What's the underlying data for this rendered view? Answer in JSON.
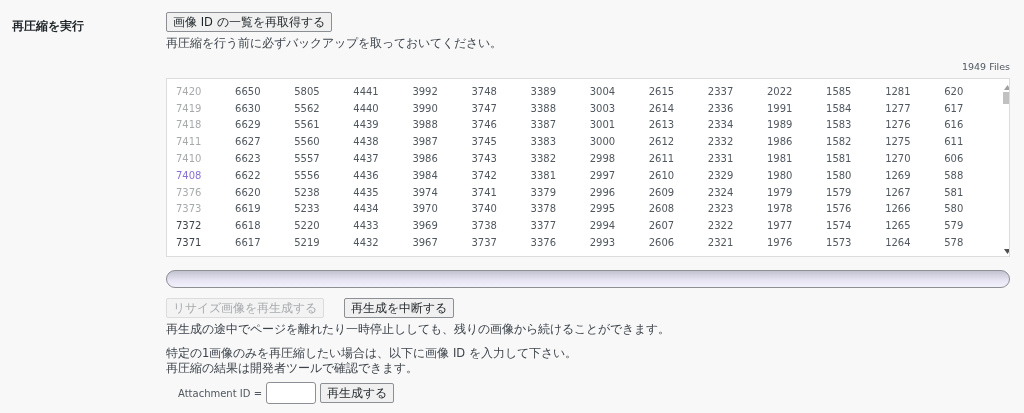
{
  "section_label": "再圧縮を実行",
  "refetch_button": {
    "label": "画像 ID の一覧を再取得する"
  },
  "backup_note": "再圧縮を行う前に必ずバックアップを取っておいてください。",
  "file_count": "1949 Files",
  "id_list": {
    "rows": [
      {
        "processed": true,
        "active": false,
        "ids": [
          "7420",
          "6650",
          "5805",
          "4441",
          "3992",
          "3748",
          "3389",
          "3004",
          "2615",
          "2337",
          "2022",
          "1585",
          "1281",
          "620"
        ]
      },
      {
        "processed": true,
        "active": false,
        "ids": [
          "7419",
          "6630",
          "5562",
          "4440",
          "3990",
          "3747",
          "3388",
          "3003",
          "2614",
          "2336",
          "1991",
          "1584",
          "1277",
          "617"
        ]
      },
      {
        "processed": true,
        "active": false,
        "ids": [
          "7418",
          "6629",
          "5561",
          "4439",
          "3988",
          "3746",
          "3387",
          "3001",
          "2613",
          "2334",
          "1989",
          "1583",
          "1276",
          "616"
        ]
      },
      {
        "processed": true,
        "active": false,
        "ids": [
          "7411",
          "6627",
          "5560",
          "4438",
          "3987",
          "3745",
          "3383",
          "3000",
          "2612",
          "2332",
          "1986",
          "1582",
          "1275",
          "611"
        ]
      },
      {
        "processed": true,
        "active": false,
        "ids": [
          "7410",
          "6623",
          "5557",
          "4437",
          "3986",
          "3743",
          "3382",
          "2998",
          "2611",
          "2331",
          "1981",
          "1581",
          "1270",
          "606"
        ]
      },
      {
        "processed": false,
        "active": true,
        "ids": [
          "7408",
          "6622",
          "5556",
          "4436",
          "3984",
          "3742",
          "3381",
          "2997",
          "2610",
          "2329",
          "1980",
          "1580",
          "1269",
          "588"
        ]
      },
      {
        "processed": true,
        "active": false,
        "ids": [
          "7376",
          "6620",
          "5238",
          "4435",
          "3974",
          "3741",
          "3379",
          "2996",
          "2609",
          "2324",
          "1979",
          "1579",
          "1267",
          "581"
        ]
      },
      {
        "processed": true,
        "active": false,
        "ids": [
          "7373",
          "6619",
          "5233",
          "4434",
          "3970",
          "3740",
          "3378",
          "2995",
          "2608",
          "2323",
          "1978",
          "1576",
          "1266",
          "580"
        ]
      },
      {
        "processed": false,
        "active": false,
        "ids": [
          "7372",
          "6618",
          "5220",
          "4433",
          "3969",
          "3738",
          "3377",
          "2994",
          "2607",
          "2322",
          "1977",
          "1574",
          "1265",
          "579"
        ]
      },
      {
        "processed": false,
        "active": false,
        "ids": [
          "7371",
          "6617",
          "5219",
          "4432",
          "3967",
          "3737",
          "3376",
          "2993",
          "2606",
          "2321",
          "1976",
          "1573",
          "1264",
          "578"
        ]
      }
    ]
  },
  "progress": {
    "level": 0
  },
  "regenerate_button": {
    "label": "リサイズ画像を再生成する",
    "disabled": true
  },
  "abort_button": {
    "label": "再生成を中断する",
    "disabled": false
  },
  "resume_note": "再生成の途中でページを離れたり一時停止ししても、残りの画像から続けることができます。",
  "single_note": [
    "特定の1画像のみを再圧縮したい場合は、以下に画像 ID を入力して下さい。",
    "再圧縮の結果は開発者ツールで確認できます。"
  ],
  "attachment": {
    "label": "Attachment ID =",
    "button": "再生成する"
  }
}
